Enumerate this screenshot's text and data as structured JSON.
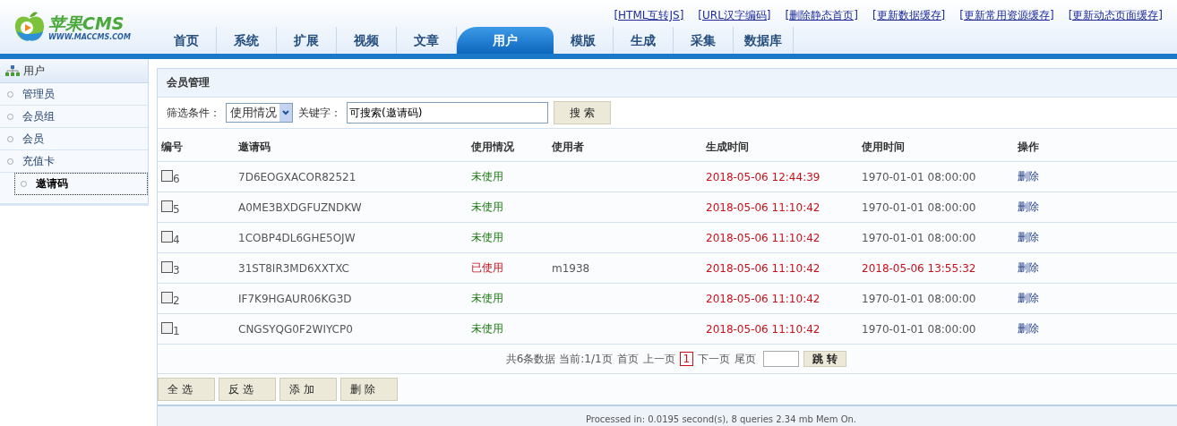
{
  "logo": {
    "title": "苹果CMS",
    "subtitle": "WWW.MACCMS.COM"
  },
  "top_links": [
    "[HTML互转JS]",
    "[URL汉字编码]",
    "[删除静态首页]",
    "[更新数据缓存]",
    "[更新常用资源缓存]",
    "[更新动态页面缓存]"
  ],
  "nav_tabs": [
    {
      "label": "首页",
      "selected": false
    },
    {
      "label": "系统",
      "selected": false
    },
    {
      "label": "扩展",
      "selected": false
    },
    {
      "label": "视频",
      "selected": false
    },
    {
      "label": "文章",
      "selected": false
    },
    {
      "label": "用户",
      "selected": true
    },
    {
      "label": "模版",
      "selected": false
    },
    {
      "label": "生成",
      "selected": false
    },
    {
      "label": "采集",
      "selected": false
    },
    {
      "label": "数据库",
      "selected": false
    }
  ],
  "sidebar": {
    "title": "用户",
    "items": [
      {
        "label": "管理员",
        "selected": false
      },
      {
        "label": "会员组",
        "selected": false
      },
      {
        "label": "会员",
        "selected": false
      },
      {
        "label": "充值卡",
        "selected": false
      },
      {
        "label": "邀请码",
        "selected": true
      }
    ]
  },
  "panel": {
    "title": "会员管理",
    "filter_label": "筛选条件：",
    "filter_value": "使用情况",
    "keyword_label": "关键字：",
    "keyword_value": "可搜索(邀请码)",
    "search_button": "搜 索"
  },
  "table": {
    "columns": [
      "编号",
      "邀请码",
      "使用情况",
      "使用者",
      "生成时间",
      "使用时间",
      "操作"
    ],
    "rows": [
      {
        "id": "6",
        "code": "7D6EOGXACOR82521",
        "status": "未使用",
        "used": false,
        "user": "",
        "created": "2018-05-06 12:44:39",
        "used_time": "1970-01-01 08:00:00",
        "action": "删除",
        "checked": false
      },
      {
        "id": "5",
        "code": "A0ME3BXDGFUZNDKW",
        "status": "未使用",
        "used": false,
        "user": "",
        "created": "2018-05-06 11:10:42",
        "used_time": "1970-01-01 08:00:00",
        "action": "删除",
        "checked": false
      },
      {
        "id": "4",
        "code": "1COBP4DL6GHE5OJW",
        "status": "未使用",
        "used": false,
        "user": "",
        "created": "2018-05-06 11:10:42",
        "used_time": "1970-01-01 08:00:00",
        "action": "删除",
        "checked": false
      },
      {
        "id": "3",
        "code": "31ST8IR3MD6XXTXC",
        "status": "已使用",
        "used": true,
        "user": "m1938",
        "created": "2018-05-06 11:10:42",
        "used_time": "2018-05-06 13:55:32",
        "action": "删除",
        "checked": false
      },
      {
        "id": "2",
        "code": "IF7K9HGAUR06KG3D",
        "status": "未使用",
        "used": false,
        "user": "",
        "created": "2018-05-06 11:10:42",
        "used_time": "1970-01-01 08:00:00",
        "action": "删除",
        "checked": false
      },
      {
        "id": "1",
        "code": "CNGSYQG0F2WIYCP0",
        "status": "未使用",
        "used": false,
        "user": "",
        "created": "2018-05-06 11:10:42",
        "used_time": "1970-01-01 08:00:00",
        "action": "删除",
        "checked": false
      }
    ]
  },
  "pagination": {
    "summary": "共6条数据 当前:1/1页",
    "first": "首页",
    "prev": "上一页",
    "pages": [
      {
        "label": "1",
        "selected": true
      }
    ],
    "next": "下一页",
    "last": "尾页",
    "jump_button": "跳 转"
  },
  "actions": [
    "全 选",
    "反 选",
    "添 加",
    "删 除"
  ],
  "footer": "Processed in: 0.0195 second(s), 8 queries 2.34 mb Mem On."
}
